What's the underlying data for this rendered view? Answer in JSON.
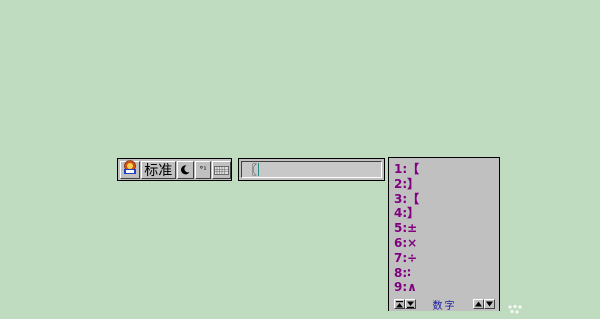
{
  "ime_bar": {
    "mode_label": "标准",
    "punct_label": "°¹",
    "icons": [
      "ime-logo-icon",
      "half-moon-icon",
      "punctuation-icon",
      "keyboard-icon"
    ]
  },
  "composition": {
    "text": "〖"
  },
  "candidates": {
    "items": [
      "1:【",
      "2:】",
      "3:【",
      "4:】",
      "5:±",
      "6:×",
      "7:÷",
      "8:∶",
      "9:∧"
    ],
    "mode_label": "数字"
  },
  "colors": {
    "desktop": "#c0dcc0",
    "candidate_text": "#800080",
    "mode_text": "#1a1aa0"
  }
}
